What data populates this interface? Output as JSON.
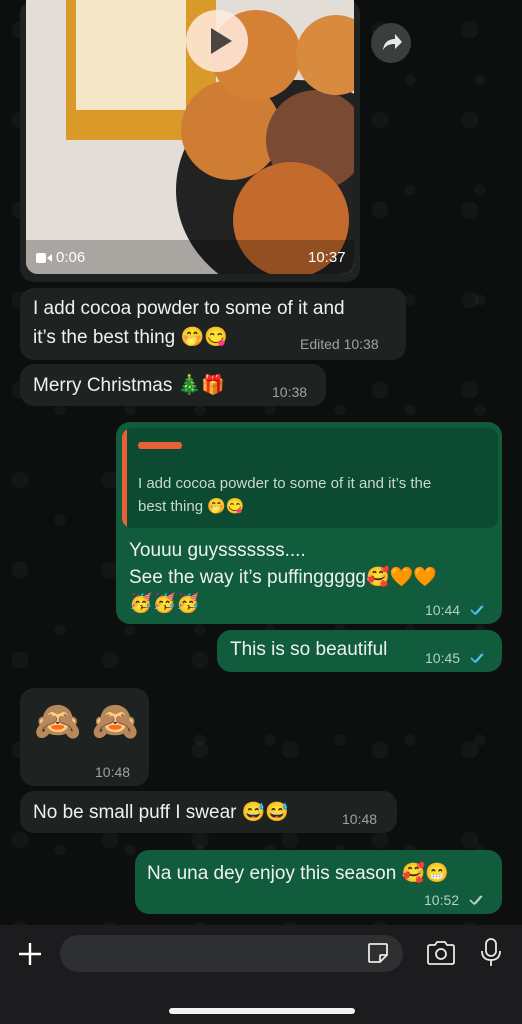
{
  "video": {
    "duration": "0:06",
    "time": "10:37"
  },
  "messages": [
    {
      "id": "m1",
      "text": "I add cocoa powder to some of it and",
      "text2": "it’s the best thing 🤭😋",
      "time": "Edited 10:38"
    },
    {
      "id": "m2",
      "text": "Merry Christmas 🎄🎁",
      "time": "10:38"
    },
    {
      "id": "m3",
      "reply_quote_1": "I add cocoa powder to some of it and it’s the",
      "reply_quote_2": "best thing 🤭😋",
      "line1": "Youuu guysssssss....",
      "line2": "See the way it’s puffinggggg🥰🧡🧡",
      "line3": "🥳🥳🥳",
      "time": "10:44"
    },
    {
      "id": "m4",
      "text": "This is so beautiful",
      "time": "10:45"
    },
    {
      "id": "m5",
      "text": "🙈 🙈",
      "time": "10:48"
    },
    {
      "id": "m6",
      "text": "No be small puff I swear 😅😅",
      "time": "10:48"
    },
    {
      "id": "m7",
      "text": "Na una dey enjoy this season 🥰😁",
      "time": "10:52"
    }
  ],
  "colors": {
    "incoming": "#1e2322",
    "outgoing": "#105c3d",
    "read_ticks": "#53bdeb",
    "delivered_ticks": "#b5cfc3"
  },
  "icons": [
    "play-icon",
    "forward-icon",
    "video-camera-icon",
    "plus-icon",
    "sticker-icon",
    "camera-icon",
    "microphone-icon",
    "double-check-icon"
  ]
}
